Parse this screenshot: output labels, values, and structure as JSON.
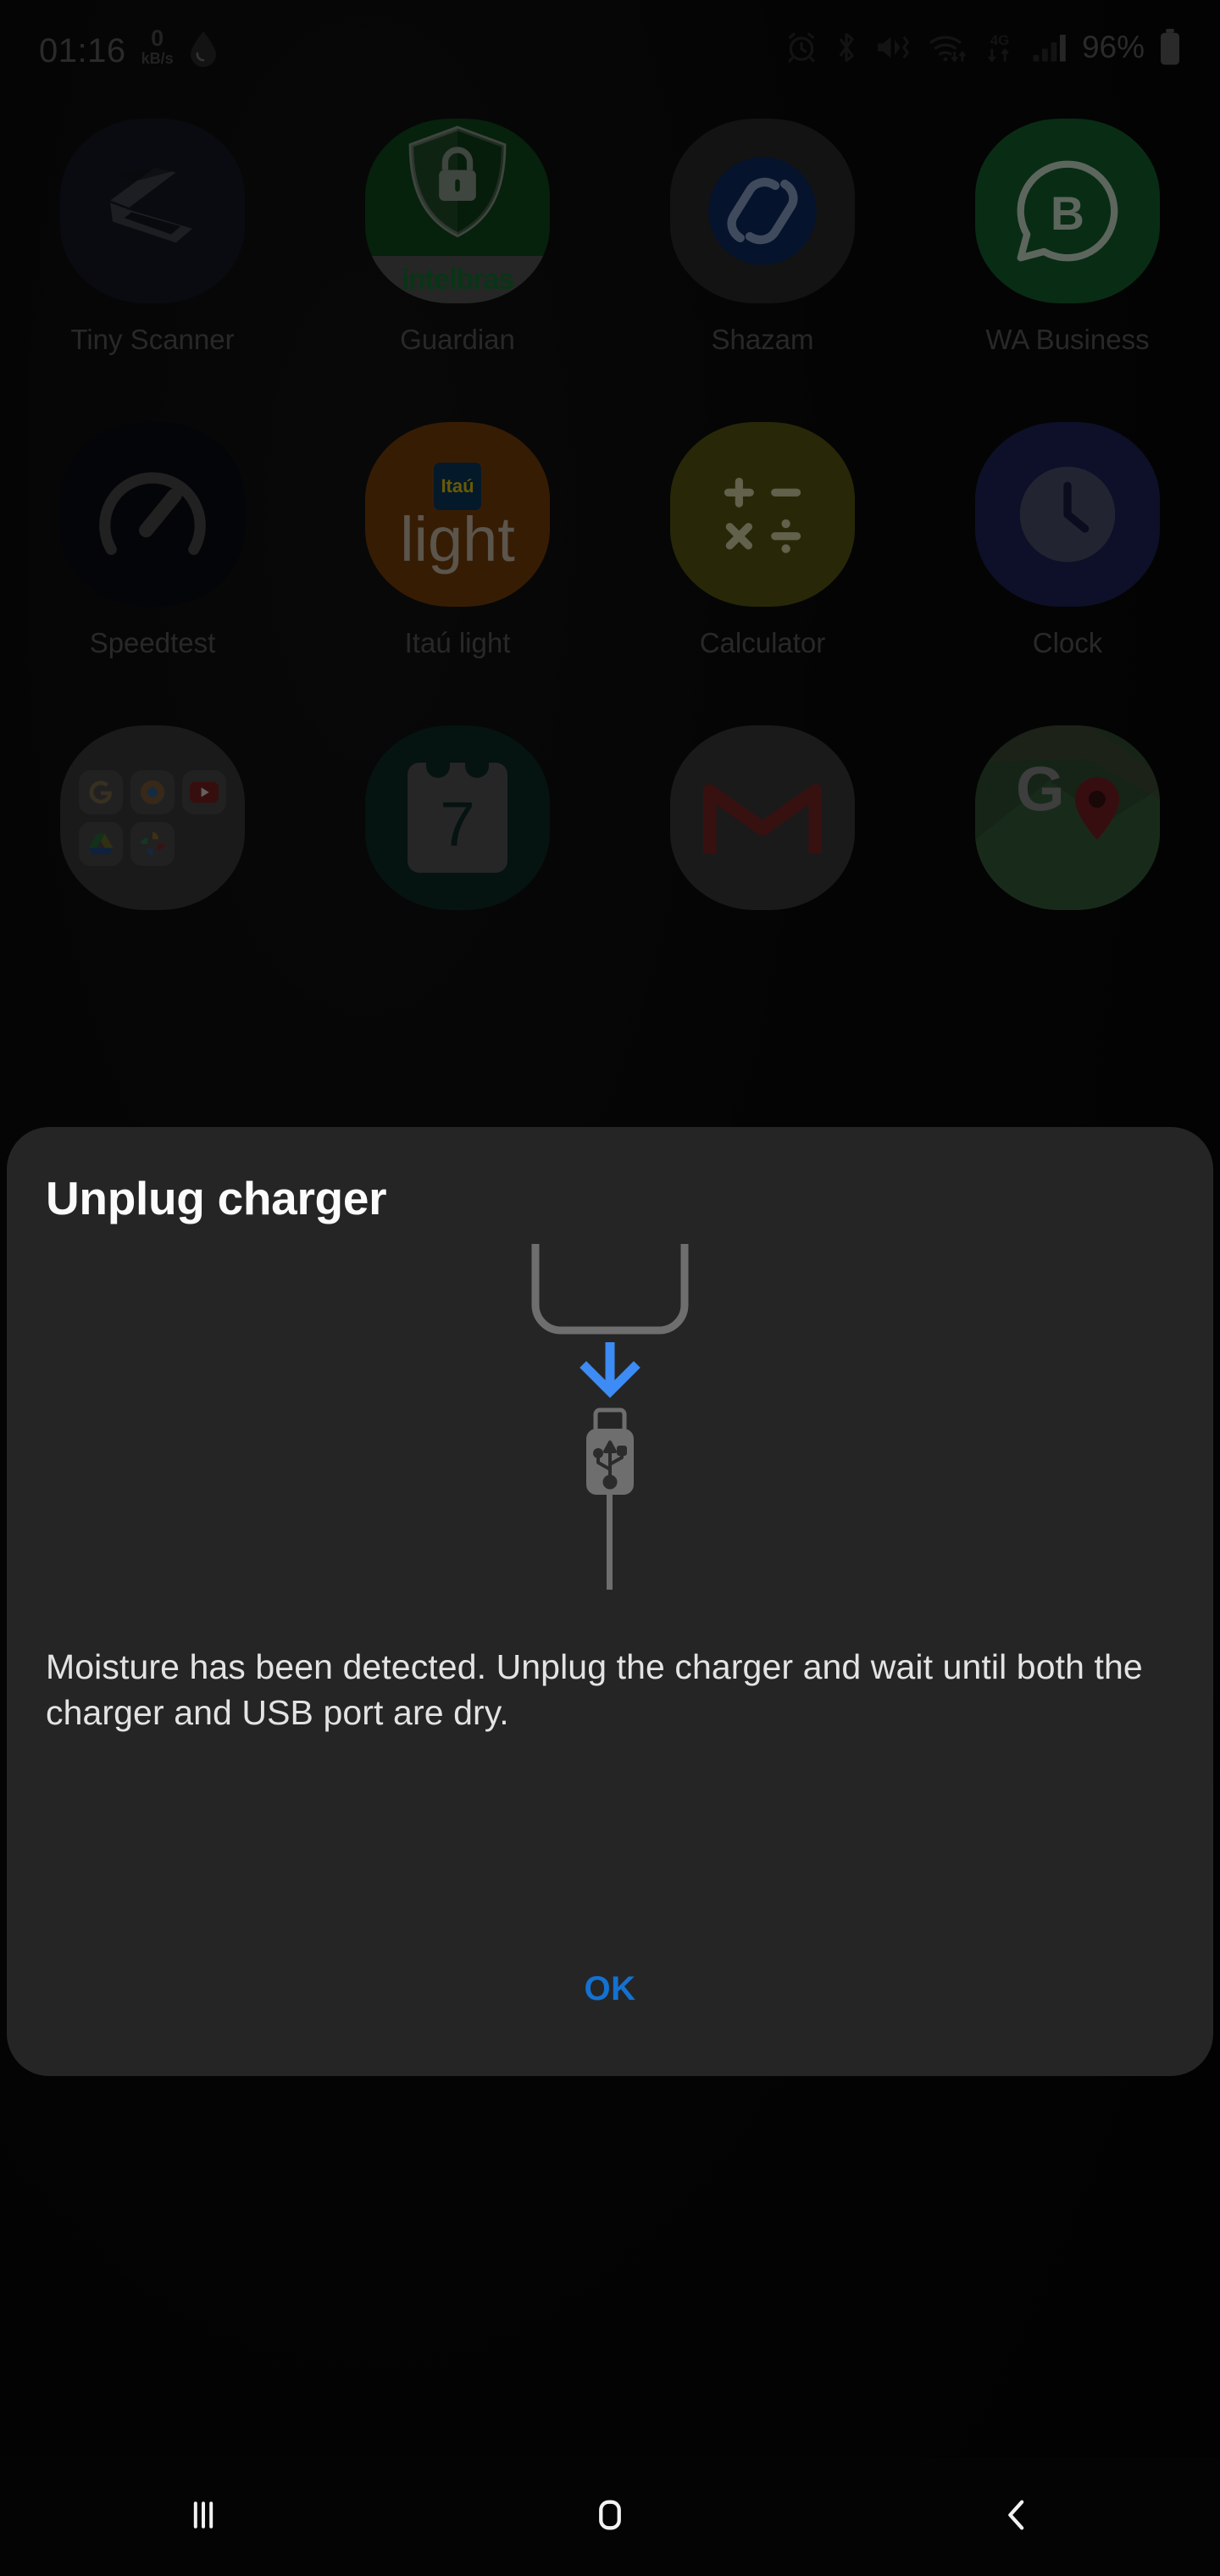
{
  "status_bar": {
    "clock": "01:16",
    "net_speed_value": "0",
    "net_speed_unit": "kB/s",
    "moisture_icon": "water-drop-icon",
    "alarm_icon": "alarm-icon",
    "bluetooth_icon": "bluetooth-icon",
    "mute_vibrate_icon": "mute-vibrate-icon",
    "wifi_icon": "wifi-icon",
    "network_type": "4G",
    "signal_icon": "signal-bars-icon",
    "battery_percent": "96%",
    "battery_icon": "battery-icon"
  },
  "home_screen": {
    "rows": [
      [
        {
          "label": "Tiny Scanner",
          "icon": "tiny-scanner-icon"
        },
        {
          "label": "Guardian",
          "icon": "guardian-icon",
          "brand": "intelbras"
        },
        {
          "label": "Shazam",
          "icon": "shazam-icon"
        },
        {
          "label": "WA Business",
          "icon": "whatsapp-business-icon",
          "glyph": "B"
        }
      ],
      [
        {
          "label": "Speedtest",
          "icon": "speedtest-icon"
        },
        {
          "label": "Itaú light",
          "icon": "itau-light-icon",
          "badge": "Itaú",
          "sub": "light"
        },
        {
          "label": "Calculator",
          "icon": "calculator-icon"
        },
        {
          "label": "Clock",
          "icon": "clock-icon"
        }
      ],
      [
        {
          "label": "",
          "icon": "google-folder-icon",
          "minis": [
            "G",
            "",
            "",
            "",
            ""
          ]
        },
        {
          "label": "",
          "icon": "calendar-icon",
          "day": "7"
        },
        {
          "label": "",
          "icon": "gmail-icon"
        },
        {
          "label": "",
          "icon": "maps-icon"
        }
      ]
    ]
  },
  "dialog": {
    "title": "Unplug charger",
    "body": "Moisture has been detected. Unplug the charger and wait until both the charger and USB port are dry.",
    "ok_label": "OK",
    "illustration": {
      "phone_icon": "phone-bottom-outline-icon",
      "arrow_icon": "arrow-down-icon",
      "usb_icon": "usb-connector-icon",
      "arrow_color": "#3d8bf4",
      "outline_color": "#6e6e6e"
    },
    "background_color": "#252525",
    "accent_color": "#1471d2"
  },
  "nav_bar": {
    "recents_icon": "recents-icon",
    "home_icon": "home-icon",
    "back_icon": "back-icon"
  }
}
